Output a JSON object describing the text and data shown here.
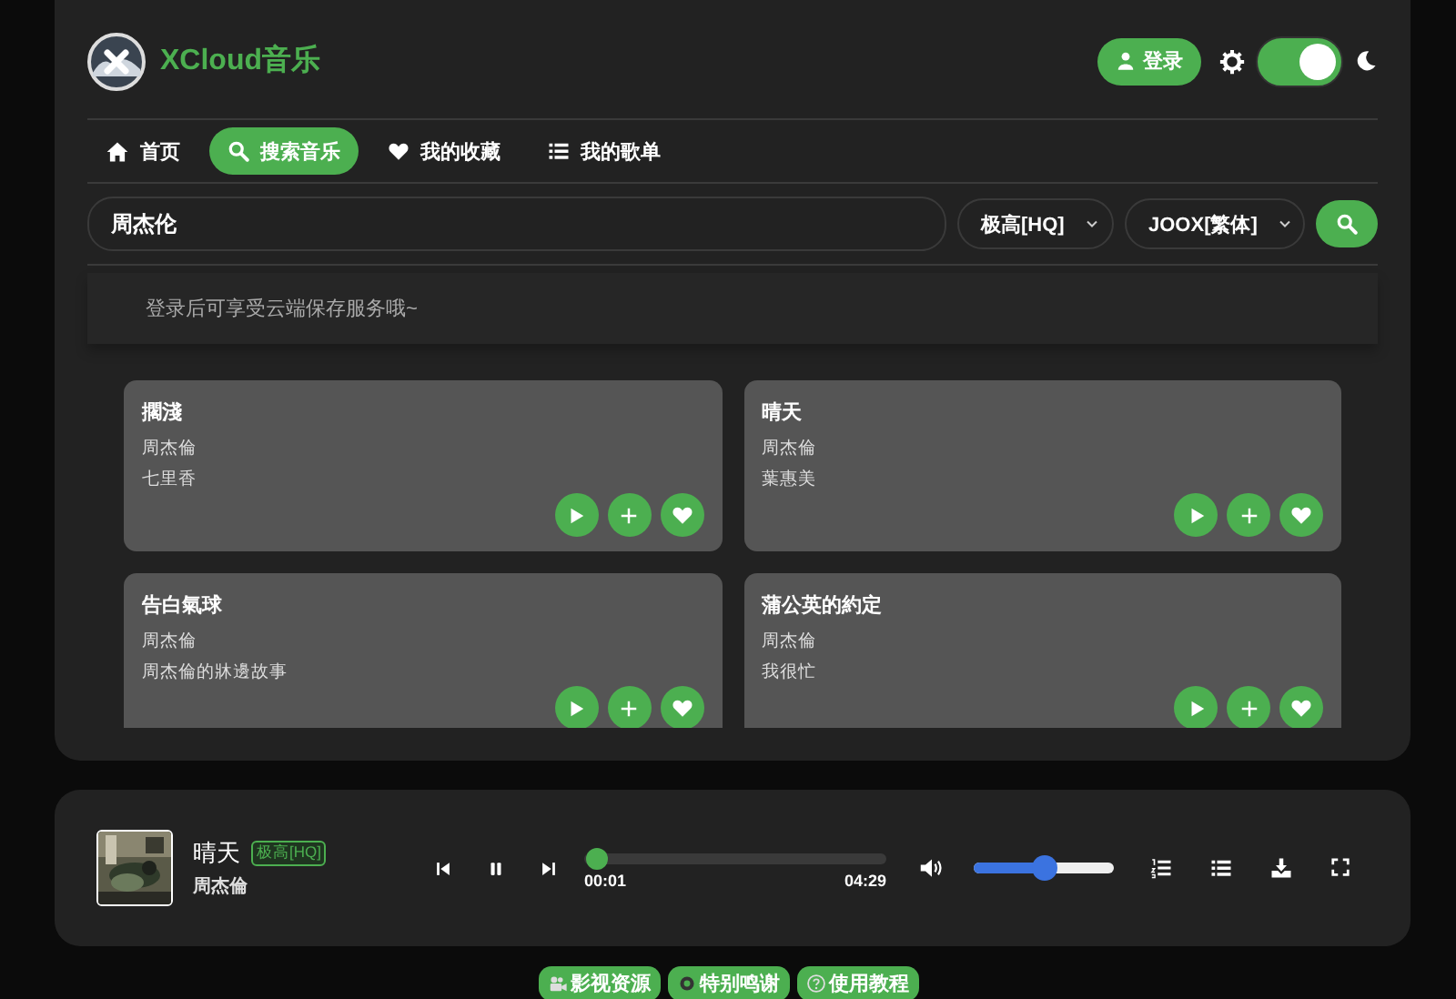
{
  "header": {
    "brand": "XCloud音乐",
    "login": "登录",
    "dark_mode": {
      "on": true
    }
  },
  "nav": [
    {
      "label": "首页",
      "kind": "home",
      "selected": false
    },
    {
      "label": "搜索音乐",
      "kind": "search",
      "selected": true
    },
    {
      "label": "我的收藏",
      "kind": "heart",
      "selected": false
    },
    {
      "label": "我的歌单",
      "kind": "list",
      "selected": false
    }
  ],
  "search": {
    "value": "周杰伦",
    "quality": "极高[HQ]",
    "source": "JOOX[繁体]"
  },
  "notice": "登录后可享受云端保存服务哦~",
  "songs": [
    {
      "title": "擱淺",
      "artist": "周杰倫",
      "album": "七里香"
    },
    {
      "title": "晴天",
      "artist": "周杰倫",
      "album": "葉惠美"
    },
    {
      "title": "告白氣球",
      "artist": "周杰倫",
      "album": "周杰倫的牀邊故事"
    },
    {
      "title": "蒲公英的約定",
      "artist": "周杰倫",
      "album": "我很忙"
    }
  ],
  "player": {
    "title": "晴天",
    "quality": "极高[HQ]",
    "artist": "周杰倫",
    "playing": true,
    "elapsed": "00:01",
    "duration": "04:29",
    "progress": {
      "level": 0.004
    },
    "volume": {
      "level": 0.5
    }
  },
  "footer_links": [
    {
      "label": "影视资源",
      "kind": "video"
    },
    {
      "label": "特别鸣谢",
      "kind": "thanks"
    },
    {
      "label": "使用教程",
      "kind": "help"
    }
  ]
}
